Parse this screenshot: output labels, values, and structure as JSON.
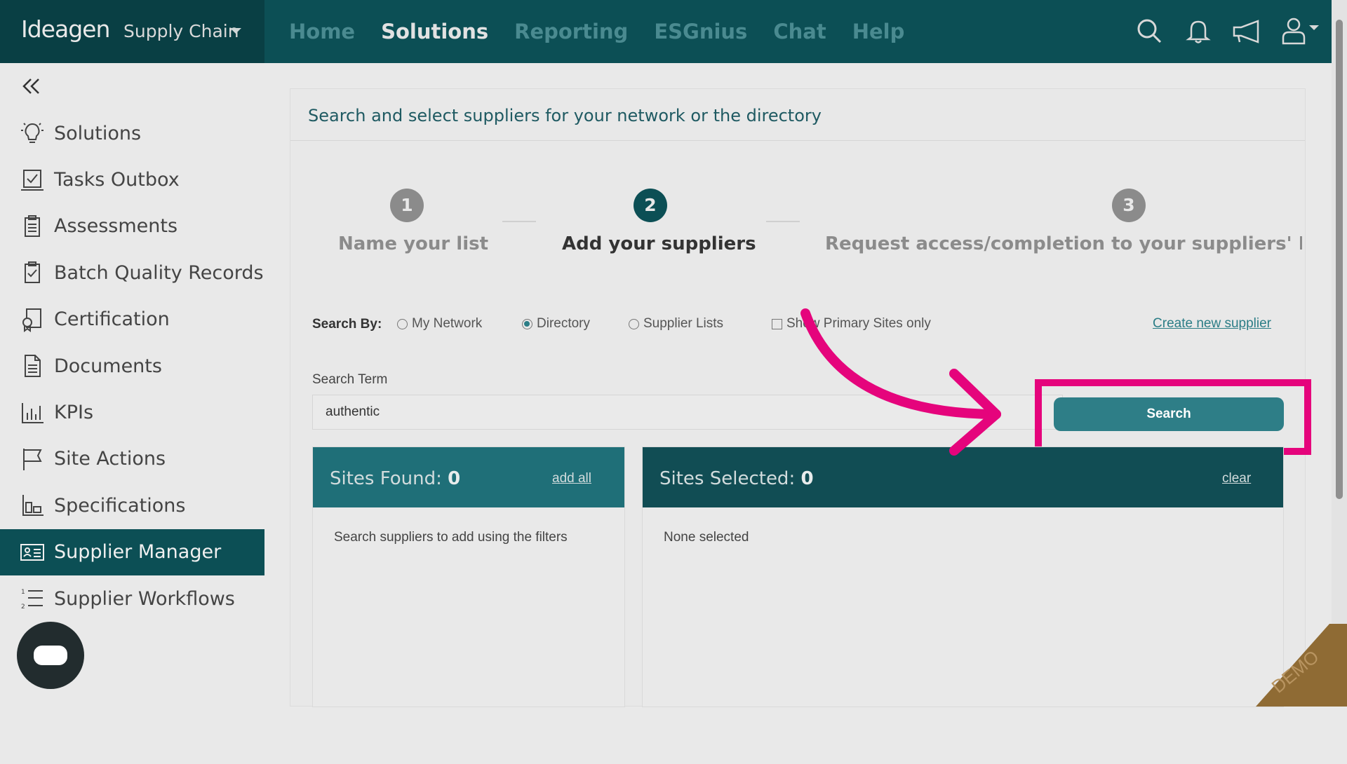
{
  "header": {
    "logo_text": "Ideagen",
    "product": "Supply Chain",
    "nav": [
      "Home",
      "Solutions",
      "Reporting",
      "ESGnius",
      "Chat",
      "Help"
    ],
    "active_nav": "Solutions"
  },
  "sidebar": {
    "items": [
      {
        "label": "Solutions",
        "icon": "lightbulb-icon"
      },
      {
        "label": "Tasks Outbox",
        "icon": "tasks-outbox-icon"
      },
      {
        "label": "Assessments",
        "icon": "clipboard-icon"
      },
      {
        "label": "Batch Quality Records",
        "icon": "clipboard-check-icon"
      },
      {
        "label": "Certification",
        "icon": "certificate-icon"
      },
      {
        "label": "Documents",
        "icon": "document-icon"
      },
      {
        "label": "KPIs",
        "icon": "bar-chart-icon"
      },
      {
        "label": "Site Actions",
        "icon": "flag-icon"
      },
      {
        "label": "Specifications",
        "icon": "specifications-icon"
      },
      {
        "label": "Supplier Manager",
        "icon": "id-card-icon"
      },
      {
        "label": "Supplier Workflows",
        "icon": "numbered-list-icon"
      }
    ],
    "active_item": "Supplier Manager"
  },
  "main": {
    "title": "Search and select suppliers for your network or the directory",
    "steps": [
      {
        "num": "1",
        "label": "Name your list",
        "state": "done"
      },
      {
        "num": "2",
        "label": "Add your suppliers",
        "state": "current"
      },
      {
        "num": "3",
        "label": "Request access/completion to your suppliers' ESG As",
        "state": "todo"
      }
    ],
    "search_by_label": "Search By:",
    "search_options": [
      {
        "label": "My Network",
        "selected": false
      },
      {
        "label": "Directory",
        "selected": true
      },
      {
        "label": "Supplier Lists",
        "selected": false
      }
    ],
    "primary_sites_label": "Show Primary Sites only",
    "primary_sites_checked": false,
    "create_link": "Create new supplier",
    "search_term_label": "Search Term",
    "search_term_value": "authentic",
    "search_button": "Search",
    "found_panel": {
      "title": "Sites Found:",
      "count": "0",
      "action": "add all",
      "body": "Search suppliers to add using the filters"
    },
    "selected_panel": {
      "title": "Sites Selected:",
      "count": "0",
      "action": "clear",
      "body": "None selected"
    }
  },
  "watermark": "DEMO",
  "colors": {
    "teal_dark": "#0c4f55",
    "teal_button": "#2e7e87",
    "highlight": "#e5047c"
  }
}
